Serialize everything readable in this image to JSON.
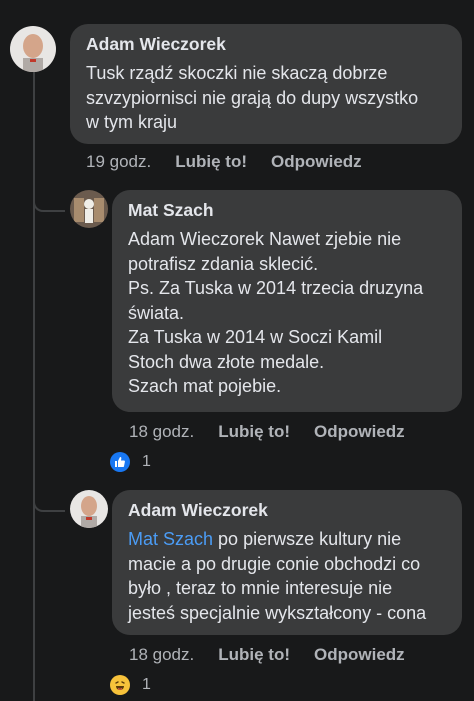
{
  "comments": [
    {
      "author": "Adam Wieczorek",
      "lines": [
        "Tusk rządź skoczki nie skaczą dobrze",
        "szvzypiornisci nie grają do dupy wszystko",
        "w tym kraju"
      ],
      "time": "19 godz.",
      "like_label": "Lubię to!",
      "reply_label": "Odpowiedz"
    },
    {
      "author": "Mat Szach",
      "lines": [
        "Adam Wieczorek Nawet zjebie nie",
        "potrafisz zdania sklecić.",
        "Ps. Za Tuska w 2014 trzecia druzyna",
        "świata.",
        "Za Tuska w 2014 w Soczi Kamil",
        "Stoch dwa złote medale.",
        "Szach mat pojebie."
      ],
      "time": "18 godz.",
      "like_label": "Lubię to!",
      "reply_label": "Odpowiedz",
      "reaction_count": "1",
      "reaction_icon": "like-icon"
    },
    {
      "author": "Adam Wieczorek",
      "mention": "Mat Szach",
      "first_line_rest": " po pierwsze kultury nie",
      "lines": [
        "macie a po drugie conie obchodzi co",
        "było , teraz to mnie interesuje nie",
        "jesteś specjalnie wykształcony - cona"
      ],
      "time": "18 godz.",
      "like_label": "Lubię to!",
      "reply_label": "Odpowiedz",
      "reaction_count": "1",
      "reaction_icon": "haha-icon"
    }
  ],
  "colors": {
    "background": "#18191a",
    "bubble": "#3a3b3c",
    "text": "#e4e6eb",
    "secondary": "#b0b3b8",
    "mention": "#4b9cf5",
    "like": "#1877f2",
    "haha": "#f7c23b"
  }
}
